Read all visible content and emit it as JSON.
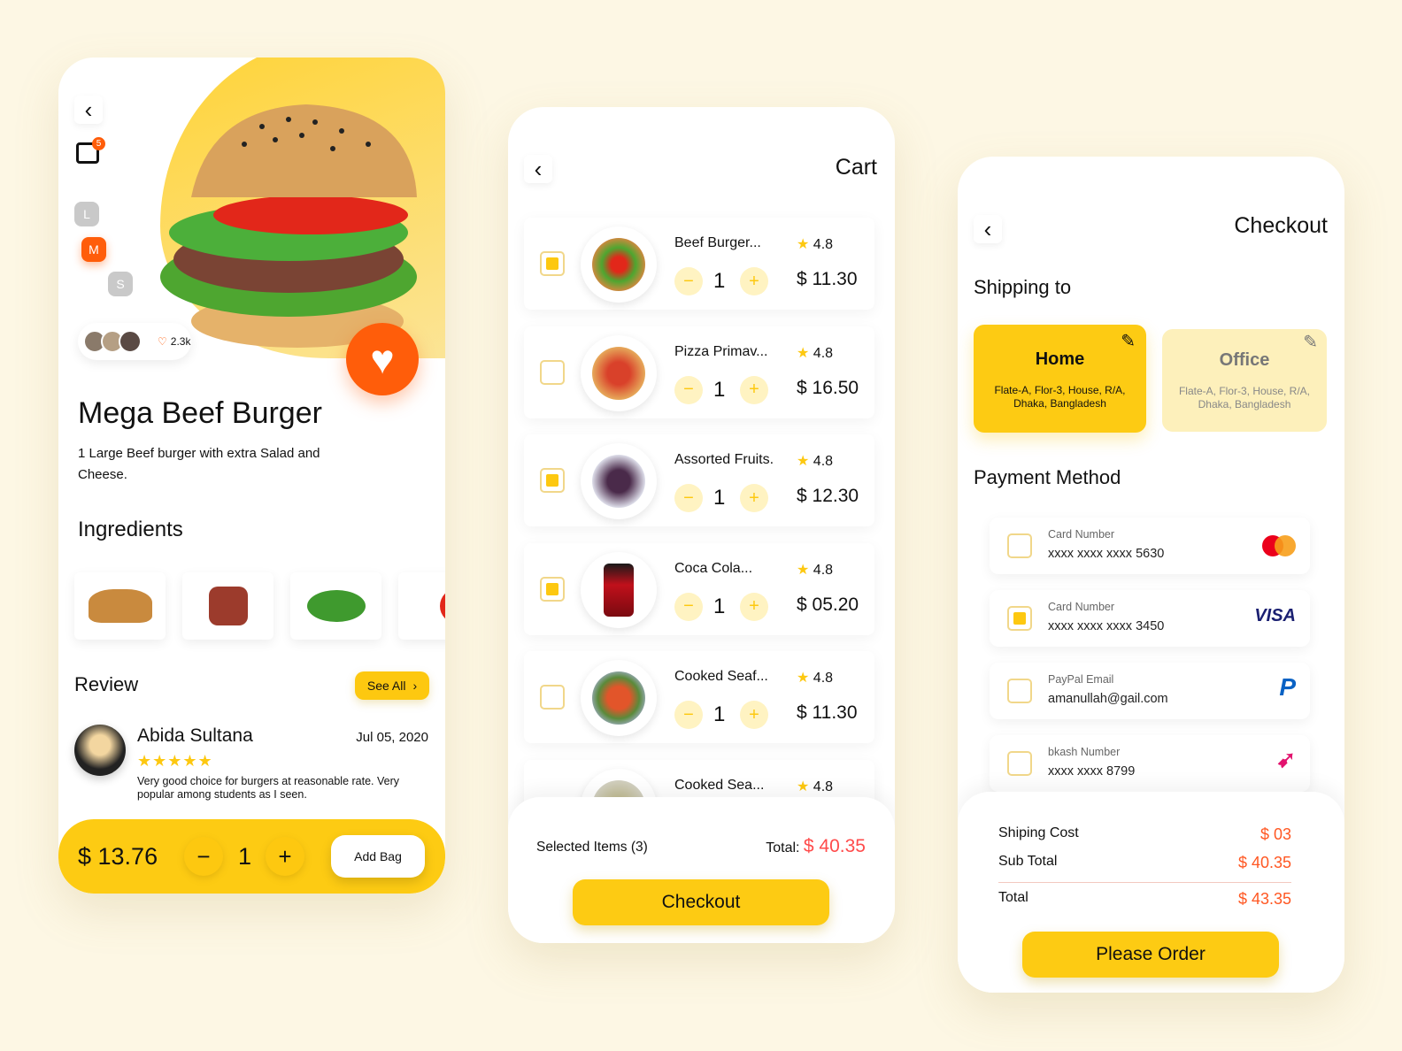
{
  "colors": {
    "accent": "#fdcb13",
    "orange": "#ff5d0a",
    "background": "#fdf7e4"
  },
  "detail": {
    "cart_badge": "5",
    "sizes": [
      "L",
      "M",
      "S"
    ],
    "selected_size": "M",
    "likes": "2.3k",
    "title": "Mega Beef Burger",
    "description": "1 Large Beef burger with extra Salad and Cheese.",
    "ingredients_title": "Ingredients",
    "review_title": "Review",
    "see_all": "See All",
    "review": {
      "name": "Abida Sultana",
      "date": "Jul 05, 2020",
      "stars": 5,
      "stars_text": "★★★★★",
      "text": "Very good choice for burgers at reasonable rate. Very popular among students as I seen."
    },
    "price": "$ 13.76",
    "minus": "−",
    "quantity": "1",
    "plus": "+",
    "add_bag": "Add Bag"
  },
  "cart": {
    "title": "Cart",
    "items": [
      {
        "name": "Beef Burger...",
        "rating": "4.8",
        "qty": "1",
        "price": "$ 11.30",
        "checked": true
      },
      {
        "name": "Pizza Primav...",
        "rating": "4.8",
        "qty": "1",
        "price": "$ 16.50",
        "checked": false
      },
      {
        "name": "Assorted Fruits.",
        "rating": "4.8",
        "qty": "1",
        "price": "$ 12.30",
        "checked": true
      },
      {
        "name": "Coca Cola...",
        "rating": "4.8",
        "qty": "1",
        "price": "$ 05.20",
        "checked": true
      },
      {
        "name": "Cooked Seaf...",
        "rating": "4.8",
        "qty": "1",
        "price": "$ 11.30",
        "checked": false
      },
      {
        "name": "Cooked Sea...",
        "rating": "4.8"
      }
    ],
    "minus": "−",
    "plus": "+",
    "star": "★",
    "selected": "Selected Items (3)",
    "total_label": "Total:",
    "total": "$ 40.35",
    "checkout": "Checkout"
  },
  "checkout": {
    "title": "Checkout",
    "shipping_title": "Shipping to",
    "addresses": [
      {
        "name": "Home",
        "address": "Flate-A, Flor-3, House, R/A, Dhaka, Bangladesh",
        "selected": true
      },
      {
        "name": "Office",
        "address": "Flate-A, Flor-3, House, R/A, Dhaka, Bangladesh",
        "selected": false
      }
    ],
    "payment_title": "Payment Method",
    "payments": [
      {
        "label": "Card Number",
        "value": "xxxx  xxxx  xxxx  5630",
        "logo": "MasterCard",
        "checked": false
      },
      {
        "label": "Card Number",
        "value": "xxxx  xxxx  xxxx  3450",
        "logo": "VISA",
        "checked": true
      },
      {
        "label": "PayPal Email",
        "value": "amanullah@gail.com",
        "logo": "P",
        "checked": false
      },
      {
        "label": "bkash Number",
        "value": "xxxx xxxx 8799",
        "logo": "bkash",
        "checked": false
      }
    ],
    "shipping_cost_label": "Shiping Cost",
    "shipping_cost": "$ 03",
    "subtotal_label": "Sub Total",
    "subtotal": "$ 40.35",
    "total_label": "Total",
    "total": "$ 43.35",
    "order": "Please Order"
  }
}
